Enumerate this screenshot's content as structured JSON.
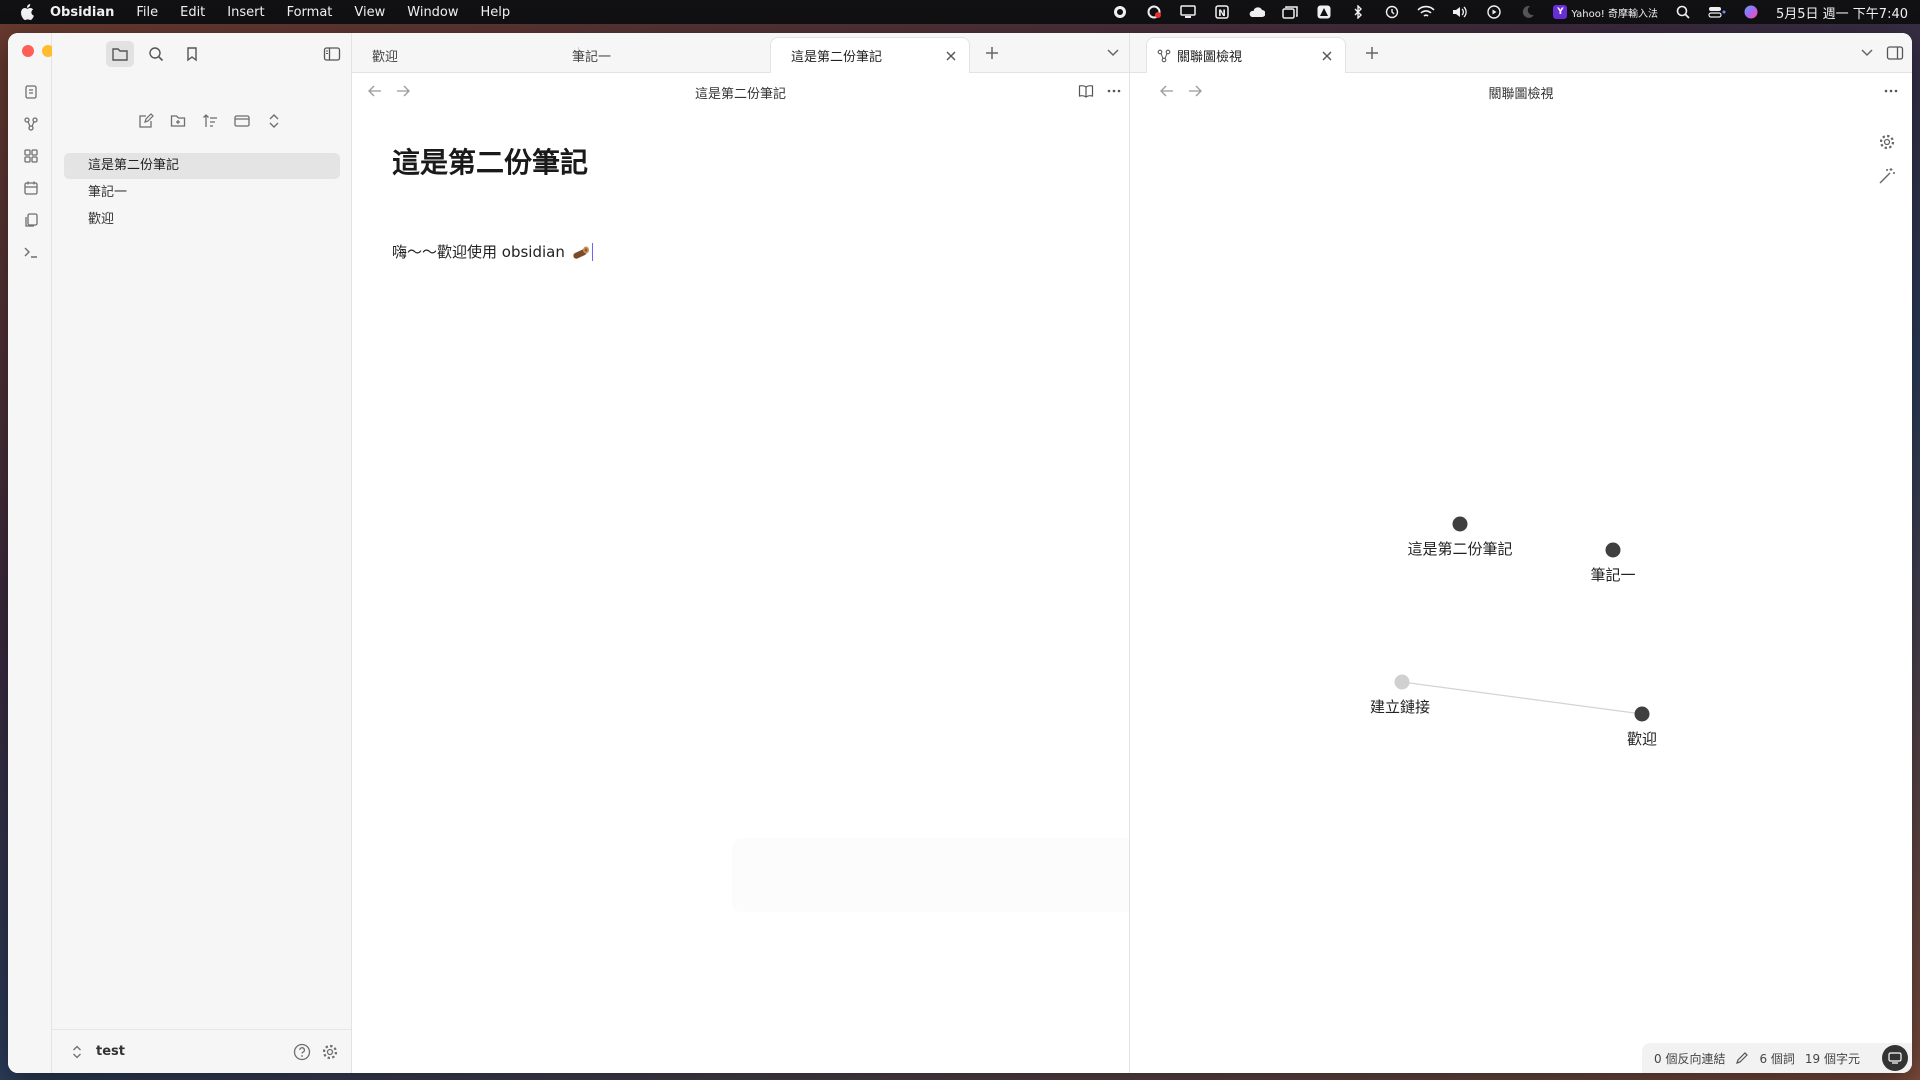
{
  "menubar": {
    "app_name": "Obsidian",
    "items": [
      "File",
      "Edit",
      "Insert",
      "Format",
      "View",
      "Window",
      "Help"
    ],
    "ime_label": "Yahoo! 奇摩輸入法",
    "clock": "5月5日 週一 下午7:40"
  },
  "sidebar": {
    "files": [
      "這是第二份筆記",
      "筆記一",
      "歡迎"
    ],
    "active_file_index": 0,
    "vault_name": "test"
  },
  "editor": {
    "tabs": [
      "歡迎",
      "筆記一",
      "這是第二份筆記"
    ],
    "active_tab_index": 2,
    "nav_title": "這是第二份筆記",
    "heading": "這是第二份筆記",
    "body": "嗨～～歡迎使用 obsidian"
  },
  "graph": {
    "tab_title": "關聯圖檢視",
    "nav_title": "關聯圖檢視",
    "nodes": [
      {
        "label": "這是第二份筆記"
      },
      {
        "label": "筆記一"
      },
      {
        "label": "建立鏈接"
      },
      {
        "label": "歡迎"
      }
    ]
  },
  "statusbar": {
    "backlinks": "0 個反向連結",
    "words": "6 個詞",
    "chars": "19 個字元"
  },
  "colors": {
    "accent": "#7a5cff",
    "node_dark": "#3f3f3f",
    "node_unresolved": "#d0d0d0"
  }
}
